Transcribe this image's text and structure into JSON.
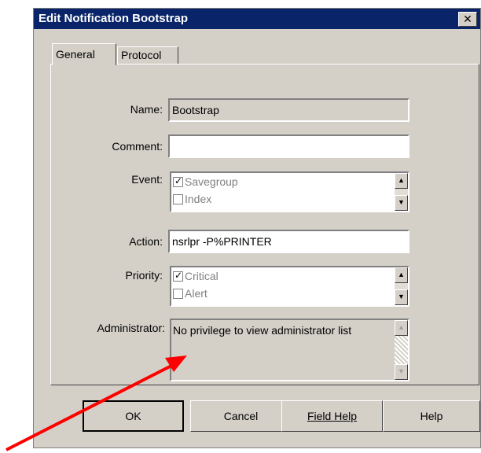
{
  "window": {
    "title": "Edit Notification Bootstrap",
    "close_glyph": "✕"
  },
  "tabs": [
    {
      "label": "General"
    },
    {
      "label": "Protocol"
    }
  ],
  "form": {
    "name": {
      "label": "Name:",
      "value": "Bootstrap"
    },
    "comment": {
      "label": "Comment:",
      "value": ""
    },
    "event": {
      "label": "Event:",
      "options": [
        {
          "label": "Savegroup",
          "checked": true
        },
        {
          "label": "Index",
          "checked": false
        }
      ]
    },
    "action": {
      "label": "Action:",
      "value": "nsrlpr -P%PRINTER"
    },
    "priority": {
      "label": "Priority:",
      "options": [
        {
          "label": "Critical",
          "checked": true
        },
        {
          "label": "Alert",
          "checked": false
        }
      ]
    },
    "administrator": {
      "label": "Administrator:",
      "value": "No privilege to view administrator list"
    }
  },
  "buttons": {
    "ok": "OK",
    "cancel": "Cancel",
    "field_help": "Field Help",
    "help": "Help"
  },
  "checkmark_glyph": "✓",
  "annotation": {
    "arrow_color": "#ff0000"
  }
}
